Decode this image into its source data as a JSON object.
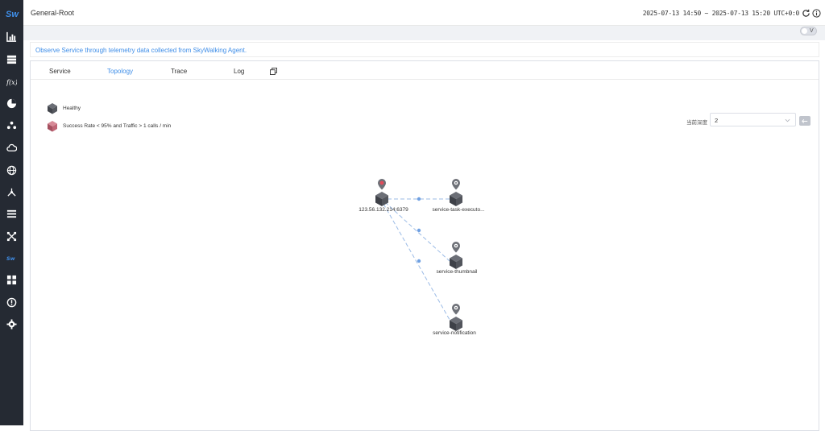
{
  "topbar": {
    "title": "General-Root",
    "time_range": "2025-07-13 14:50 ~ 2025-07-13 15:20",
    "timezone": "UTC+0:0"
  },
  "toggle": {
    "label": "V"
  },
  "notice": "Observe Service through telemetry data collected from SkyWalking Agent.",
  "tabs": [
    {
      "label": "Service"
    },
    {
      "label": "Topology"
    },
    {
      "label": "Trace"
    },
    {
      "label": "Log"
    }
  ],
  "legend": {
    "healthy": "Healthy",
    "unhealthy": "Success Rate < 95% and Traffic > 1 calls / min"
  },
  "depth": {
    "label": "当前深度",
    "value": "2"
  },
  "nodes": [
    {
      "name": "123.56.132.214:6379",
      "status": "unhealthy"
    },
    {
      "name": "service-task-executo...",
      "status": "healthy"
    },
    {
      "name": "service-thumbnail",
      "status": "healthy"
    },
    {
      "name": "service-notification",
      "status": "healthy"
    }
  ],
  "colors": {
    "accent": "#3f8ee8",
    "sidebar": "#252a33",
    "healthy": "#5b5e66",
    "unhealthy": "#c26b7a"
  },
  "sidebar": {
    "logo": "Sw",
    "icons": [
      "chart-icon",
      "database-icon",
      "function-icon",
      "pie-icon",
      "nodes-icon",
      "cloud-icon",
      "globe-icon",
      "mesh-icon",
      "list-icon",
      "shuffle-icon",
      "skywalking-icon",
      "dashboard-icon",
      "alert-icon",
      "settings-icon"
    ]
  }
}
